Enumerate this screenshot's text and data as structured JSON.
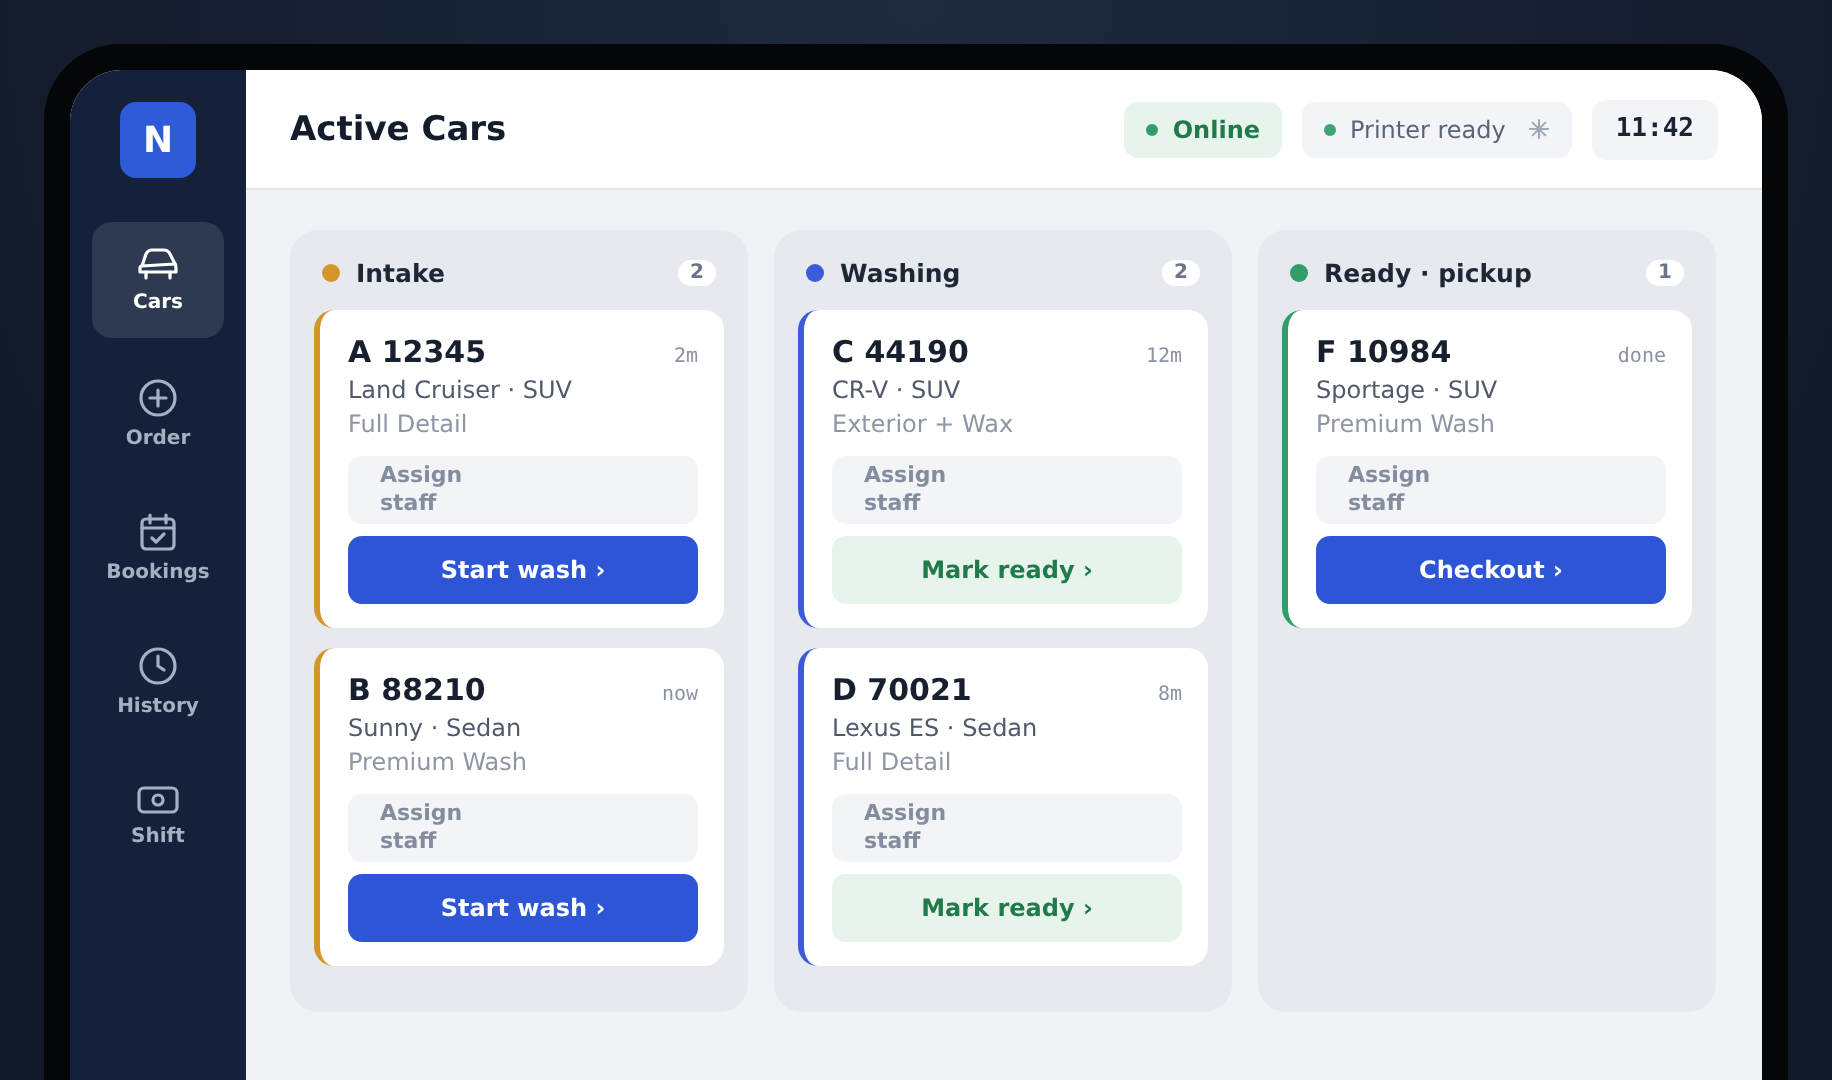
{
  "sidebar": {
    "logo": "N",
    "items": [
      {
        "label": "Cars",
        "kind": "car",
        "selected": true
      },
      {
        "label": "Order",
        "kind": "plus",
        "selected": false
      },
      {
        "label": "Bookings",
        "kind": "calendar",
        "selected": false
      },
      {
        "label": "History",
        "kind": "clock",
        "selected": false
      },
      {
        "label": "Shift",
        "kind": "cash",
        "selected": false
      }
    ]
  },
  "header": {
    "title": "Active Cars",
    "status": {
      "label": "Online",
      "on": true
    },
    "printer": {
      "label": "Printer ready",
      "on": true
    },
    "time": "11:42"
  },
  "columns": [
    {
      "title": "Intake",
      "count": "2",
      "color": "#d4962a",
      "cards": [
        {
          "plate": "A 12345",
          "age": "2m",
          "model": "Land Cruiser · SUV",
          "service": "Full Detail",
          "staff_placeholder": "Assign staff",
          "action": {
            "label": "Start wash ›",
            "kind": "primary"
          }
        },
        {
          "plate": "B 88210",
          "age": "now",
          "model": "Sunny · Sedan",
          "service": "Premium Wash",
          "staff_placeholder": "Assign staff",
          "action": {
            "label": "Start wash ›",
            "kind": "primary"
          }
        }
      ]
    },
    {
      "title": "Washing",
      "count": "2",
      "color": "#3b5bdb",
      "cards": [
        {
          "plate": "C 44190",
          "age": "12m",
          "model": "CR-V · SUV",
          "service": "Exterior + Wax",
          "staff_placeholder": "Assign staff",
          "action": {
            "label": "Mark ready ›",
            "kind": "soft"
          }
        },
        {
          "plate": "D 70021",
          "age": "8m",
          "model": "Lexus ES · Sedan",
          "service": "Full Detail",
          "staff_placeholder": "Assign staff",
          "action": {
            "label": "Mark ready ›",
            "kind": "soft"
          }
        }
      ]
    },
    {
      "title": "Ready · pickup",
      "count": "1",
      "color": "#2f9e6a",
      "cards": [
        {
          "plate": "F 10984",
          "age": "done",
          "model": "Sportage · SUV",
          "service": "Premium Wash",
          "staff_placeholder": "Assign staff",
          "action": {
            "label": "Checkout ›",
            "kind": "primary"
          }
        }
      ]
    }
  ]
}
